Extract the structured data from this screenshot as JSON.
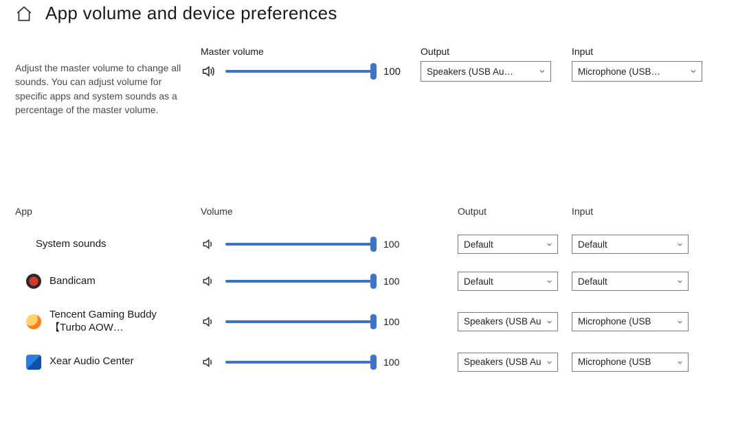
{
  "header": {
    "title": "App volume and device preferences"
  },
  "labels": {
    "master_volume": "Master volume",
    "output": "Output",
    "input": "Input",
    "app": "App",
    "volume": "Volume"
  },
  "master": {
    "description": "Adjust the master volume to change all sounds. You can adjust volume for specific apps and system sounds as a percentage of the master volume.",
    "volume": "100",
    "output": "Speakers (USB Au…",
    "input": "Microphone (USB…"
  },
  "apps": {
    "system": {
      "name": "System sounds",
      "volume": "100",
      "output": "Default",
      "input": "Default"
    },
    "bandicam": {
      "name": "Bandicam",
      "volume": "100",
      "output": "Default",
      "input": "Default"
    },
    "tencent": {
      "name": "Tencent Gaming Buddy【Turbo AOW…",
      "volume": "100",
      "output": "Speakers (USB Au",
      "input": "Microphone (USB"
    },
    "xear": {
      "name": "Xear Audio Center",
      "volume": "100",
      "output": "Speakers (USB Au",
      "input": "Microphone (USB"
    }
  }
}
